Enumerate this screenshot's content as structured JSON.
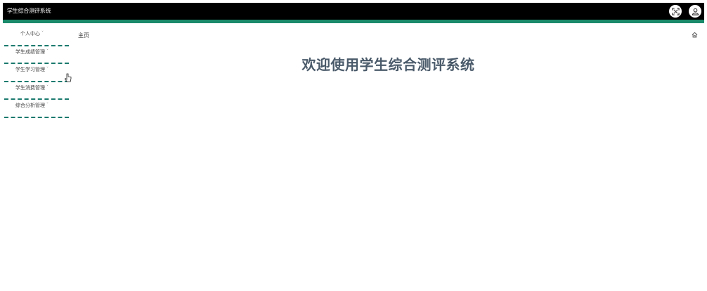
{
  "app": {
    "title": "学生综合测评系统"
  },
  "header": {
    "icons": [
      "fullscreen-icon",
      "user-icon"
    ]
  },
  "sidebar": {
    "items": [
      {
        "label": "个人中心"
      },
      {
        "label": "学生成绩管理"
      },
      {
        "label": "学生学习管理"
      },
      {
        "label": "学生消费管理"
      },
      {
        "label": "综合分析管理"
      }
    ],
    "chevron": "ˇ"
  },
  "breadcrumb": {
    "label": "主页"
  },
  "main": {
    "welcome_text": "欢迎使用学生综合测评系统"
  },
  "colors": {
    "topbar": "#000000",
    "accent": "#1b8a6b",
    "welcome": "#4a5a6a"
  }
}
